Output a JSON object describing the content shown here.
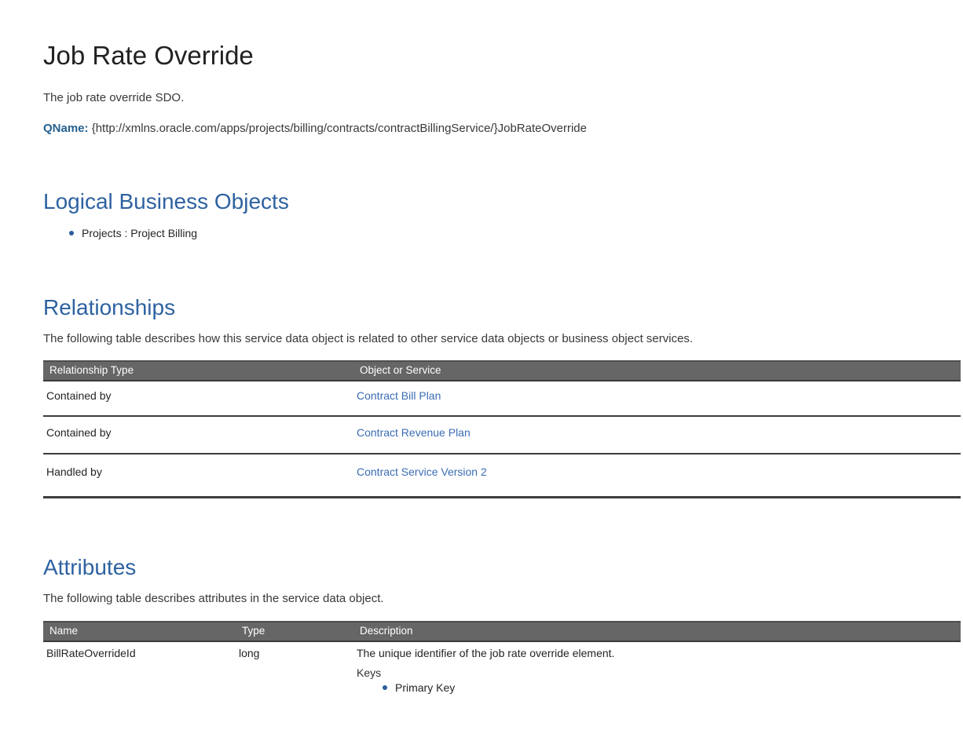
{
  "page": {
    "title": "Job Rate Override",
    "description": "The job rate override SDO.",
    "qname_label": "QName:",
    "qname_value": "{http://xmlns.oracle.com/apps/projects/billing/contracts/contractBillingService/}JobRateOverride"
  },
  "logical_business_objects": {
    "heading": "Logical Business Objects",
    "items": [
      "Projects : Project Billing"
    ]
  },
  "relationships": {
    "heading": "Relationships",
    "intro": "The following table describes how this service data object is related to other service data objects or business object services.",
    "table": {
      "headers": [
        "Relationship Type",
        "Object or Service"
      ],
      "rows": [
        {
          "relationship_type": "Contained by",
          "object_or_service": "Contract Bill Plan"
        },
        {
          "relationship_type": "Contained by",
          "object_or_service": "Contract Revenue Plan"
        },
        {
          "relationship_type": "Handled by",
          "object_or_service": "Contract Service Version 2"
        }
      ]
    }
  },
  "attributes": {
    "heading": "Attributes",
    "intro": "The following table describes attributes in the service data object.",
    "table": {
      "headers": [
        "Name",
        "Type",
        "Description"
      ],
      "rows": [
        {
          "name": "BillRateOverrideId",
          "type": "long",
          "description": "The unique identifier of the job rate override element.",
          "keys_label": "Keys",
          "keys": [
            "Primary Key"
          ]
        }
      ]
    }
  },
  "colors": {
    "heading_blue": "#2E62A1",
    "qname_label_blue": "#26618F",
    "link_blue": "#3A6CB4",
    "bullet_blue": "#2A5E9E",
    "table_header_bg": "#666666",
    "table_header_text": "#ffffff",
    "table_border_dark": "#3d3d3d",
    "body_text": "#383838"
  }
}
